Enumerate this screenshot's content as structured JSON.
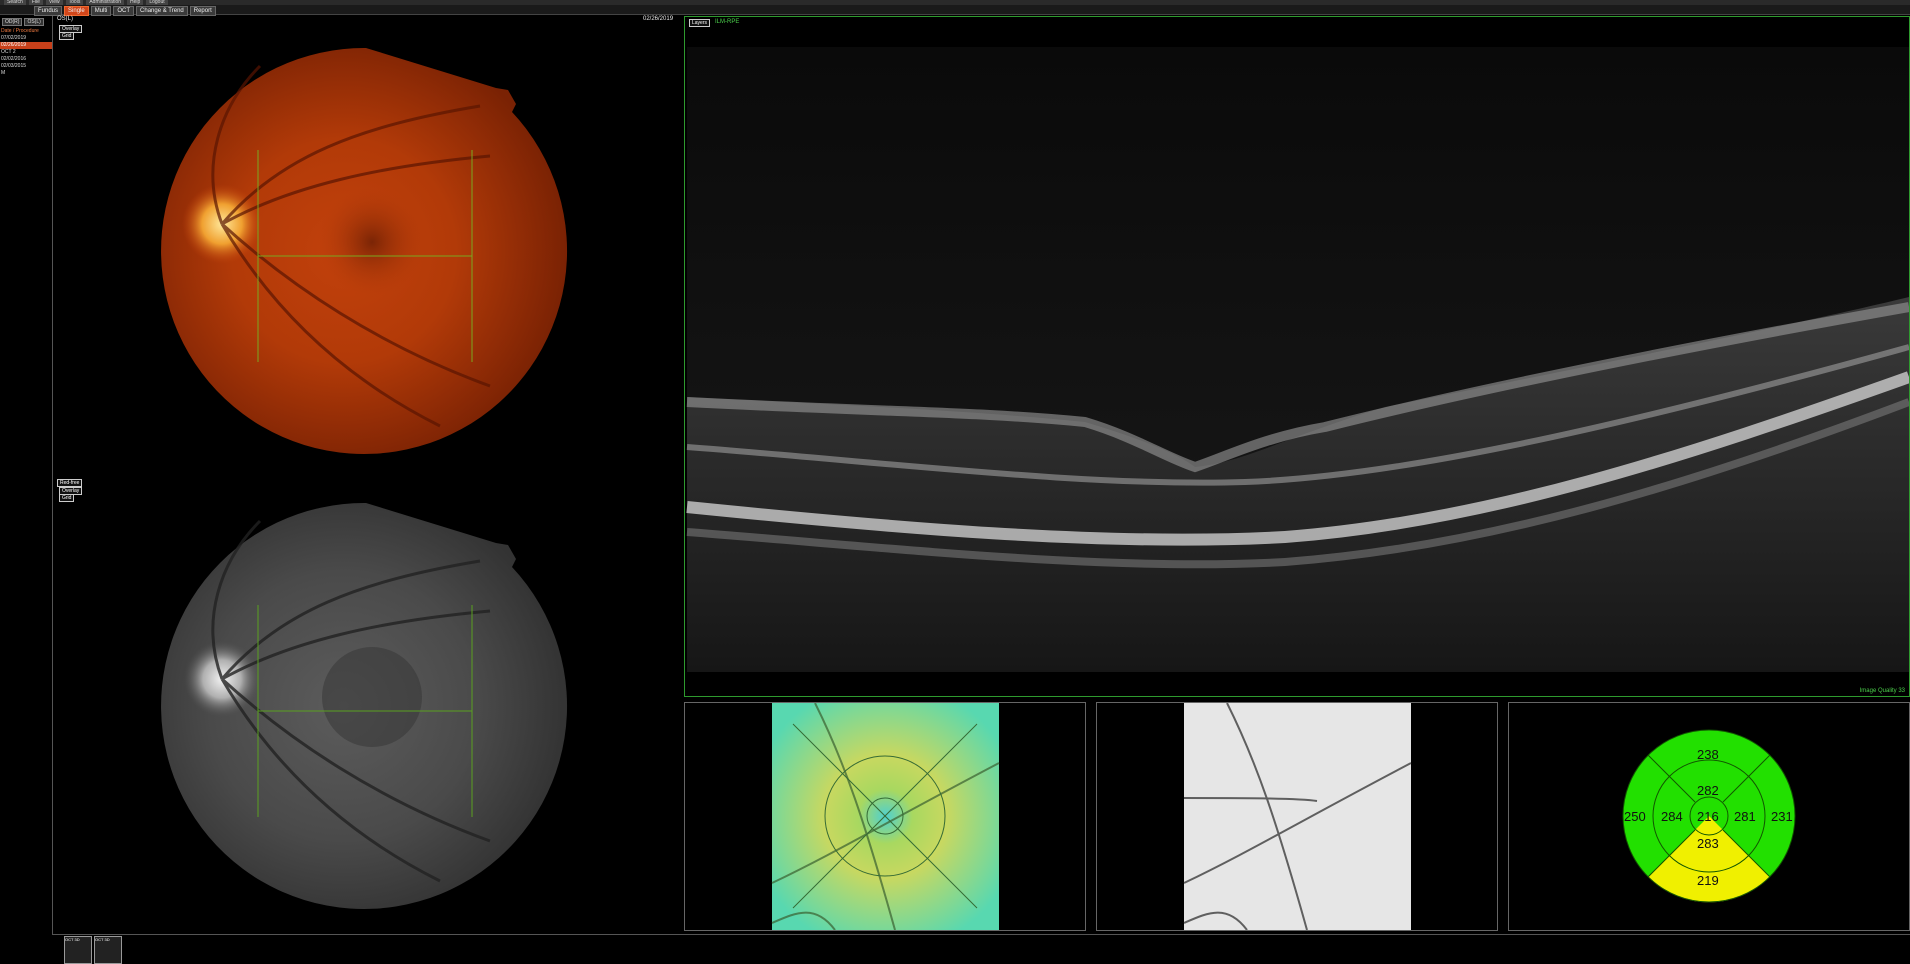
{
  "menu": [
    "Search",
    "File",
    "View",
    "Tools",
    "Administration",
    "Help",
    "Logout"
  ],
  "toolbar": {
    "buttons": [
      "Fundus",
      "Single",
      "Multi",
      "OCT",
      "Change & Trend",
      "Report"
    ],
    "active_index": 1
  },
  "sidebar": {
    "tabs": [
      "OD(R)",
      "OS(L)"
    ],
    "rows": [
      {
        "text": "Date / Procedure",
        "kind": "hdr"
      },
      {
        "text": "07/02/2019",
        "kind": "normal"
      },
      {
        "text": "02/26/2019",
        "kind": "sel"
      },
      {
        "text": "OCT            2",
        "kind": "normal"
      },
      {
        "text": "02/02/2016",
        "kind": "normal"
      },
      {
        "text": "02/03/2015",
        "kind": "normal"
      },
      {
        "text": "M",
        "kind": "normal"
      }
    ]
  },
  "fundus_top": {
    "eye_label": "OS(L)",
    "date": "02/26/2019",
    "overlay_label": "Overlay",
    "grid_label": "Grid"
  },
  "fundus_bottom": {
    "tag": "Red-free",
    "overlay_label": "Overlay",
    "grid_label": "Grid"
  },
  "oct": {
    "layers_label": "Layers",
    "scan_label": "ILM-RPE",
    "image_quality": "Image Quality 33"
  },
  "thickness_map": {
    "superior_outer": "238",
    "superior_inner": "282",
    "nasal_outer": "250",
    "nasal_inner": "284",
    "center": "216",
    "temporal_inner": "281",
    "temporal_outer": "231",
    "inferior_inner": "283",
    "inferior_outer": "219",
    "colors": {
      "normal": "#22e000",
      "borderline": "#f0f000"
    }
  },
  "thumbnails": [
    "OCT 3D",
    "OCT 3D"
  ]
}
